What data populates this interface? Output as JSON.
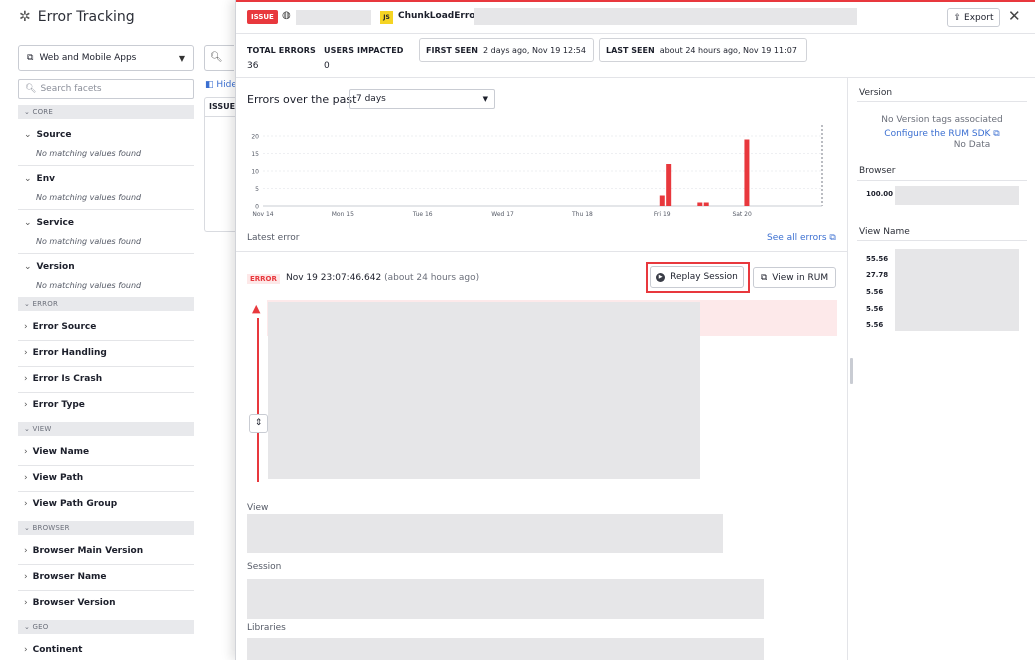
{
  "app": {
    "title": "Error Tracking",
    "scope_select": "Web and Mobile Apps",
    "facet_search_placeholder": "Search facets",
    "mid_hide_label": "Hide",
    "mid_col_header": "ISSUE",
    "sections": [
      {
        "label": "CORE"
      },
      {
        "label": "ERROR"
      },
      {
        "label": "VIEW"
      },
      {
        "label": "BROWSER"
      },
      {
        "label": "GEO"
      }
    ],
    "core_facets": [
      {
        "label": "Source",
        "note": "No matching values found"
      },
      {
        "label": "Env",
        "note": "No matching values found"
      },
      {
        "label": "Service",
        "note": "No matching values found"
      },
      {
        "label": "Version",
        "note": "No matching values found"
      }
    ],
    "error_facets": [
      "Error Source",
      "Error Handling",
      "Error Is Crash",
      "Error Type"
    ],
    "view_facets": [
      "View Name",
      "View Path",
      "View Path Group"
    ],
    "browser_facets": [
      "Browser Main Version",
      "Browser Name",
      "Browser Version"
    ],
    "geo_facets": [
      "Continent"
    ]
  },
  "panel": {
    "issue_badge": "ISSUE",
    "js_badge": "JS",
    "error_type": "ChunkLoadError:",
    "export_label": "Export",
    "stats": {
      "total_errors_label": "TOTAL ERRORS",
      "total_errors_value": "36",
      "users_impacted_label": "USERS IMPACTED",
      "users_impacted_value": "0"
    },
    "first_seen": {
      "label": "FIRST SEEN",
      "value": "2 days ago, Nov 19 12:54"
    },
    "last_seen": {
      "label": "LAST SEEN",
      "value": "about 24 hours ago, Nov 19 11:07"
    },
    "errors_over_label": "Errors over the past",
    "period_select": "7 days",
    "latest_error_label": "Latest error",
    "see_all_label": "See all errors",
    "error_badge": "ERROR",
    "error_time": "Nov 19 23:07:46.642",
    "error_time_relative": "(about 24 hours ago)",
    "replay_label": "Replay Session",
    "view_in_rum_label": "View in RUM",
    "sections": {
      "view": "View",
      "session": "Session",
      "libraries": "Libraries"
    }
  },
  "right": {
    "version_header": "Version",
    "version_note": "No Version tags associated",
    "configure_link": "Configure the RUM SDK",
    "no_data": "No Data",
    "browser_header": "Browser",
    "browser_values": [
      "100.00"
    ],
    "view_name_header": "View Name",
    "view_name_values": [
      "55.56",
      "27.78",
      "5.56",
      "5.56",
      "5.56"
    ]
  },
  "colors": {
    "accent_red": "#e8383d",
    "link_blue": "#3b6fd1",
    "js_yellow": "#f5d423"
  },
  "chart_data": {
    "type": "bar",
    "title": "",
    "ylabel": "",
    "xlabel": "",
    "ylim": [
      0,
      20
    ],
    "yticks": [
      0,
      5,
      10,
      15,
      20
    ],
    "xticks": [
      "Nov 14",
      "Mon 15",
      "Tue 16",
      "Wed 17",
      "Thu 18",
      "Fri 19",
      "Sat 20"
    ],
    "x_range_days": [
      0,
      7
    ],
    "bars": [
      {
        "day": 5.0,
        "value": 3
      },
      {
        "day": 5.08,
        "value": 12
      },
      {
        "day": 5.47,
        "value": 1
      },
      {
        "day": 5.55,
        "value": 1
      },
      {
        "day": 6.06,
        "value": 19
      }
    ],
    "bar_color": "#e8383d"
  }
}
